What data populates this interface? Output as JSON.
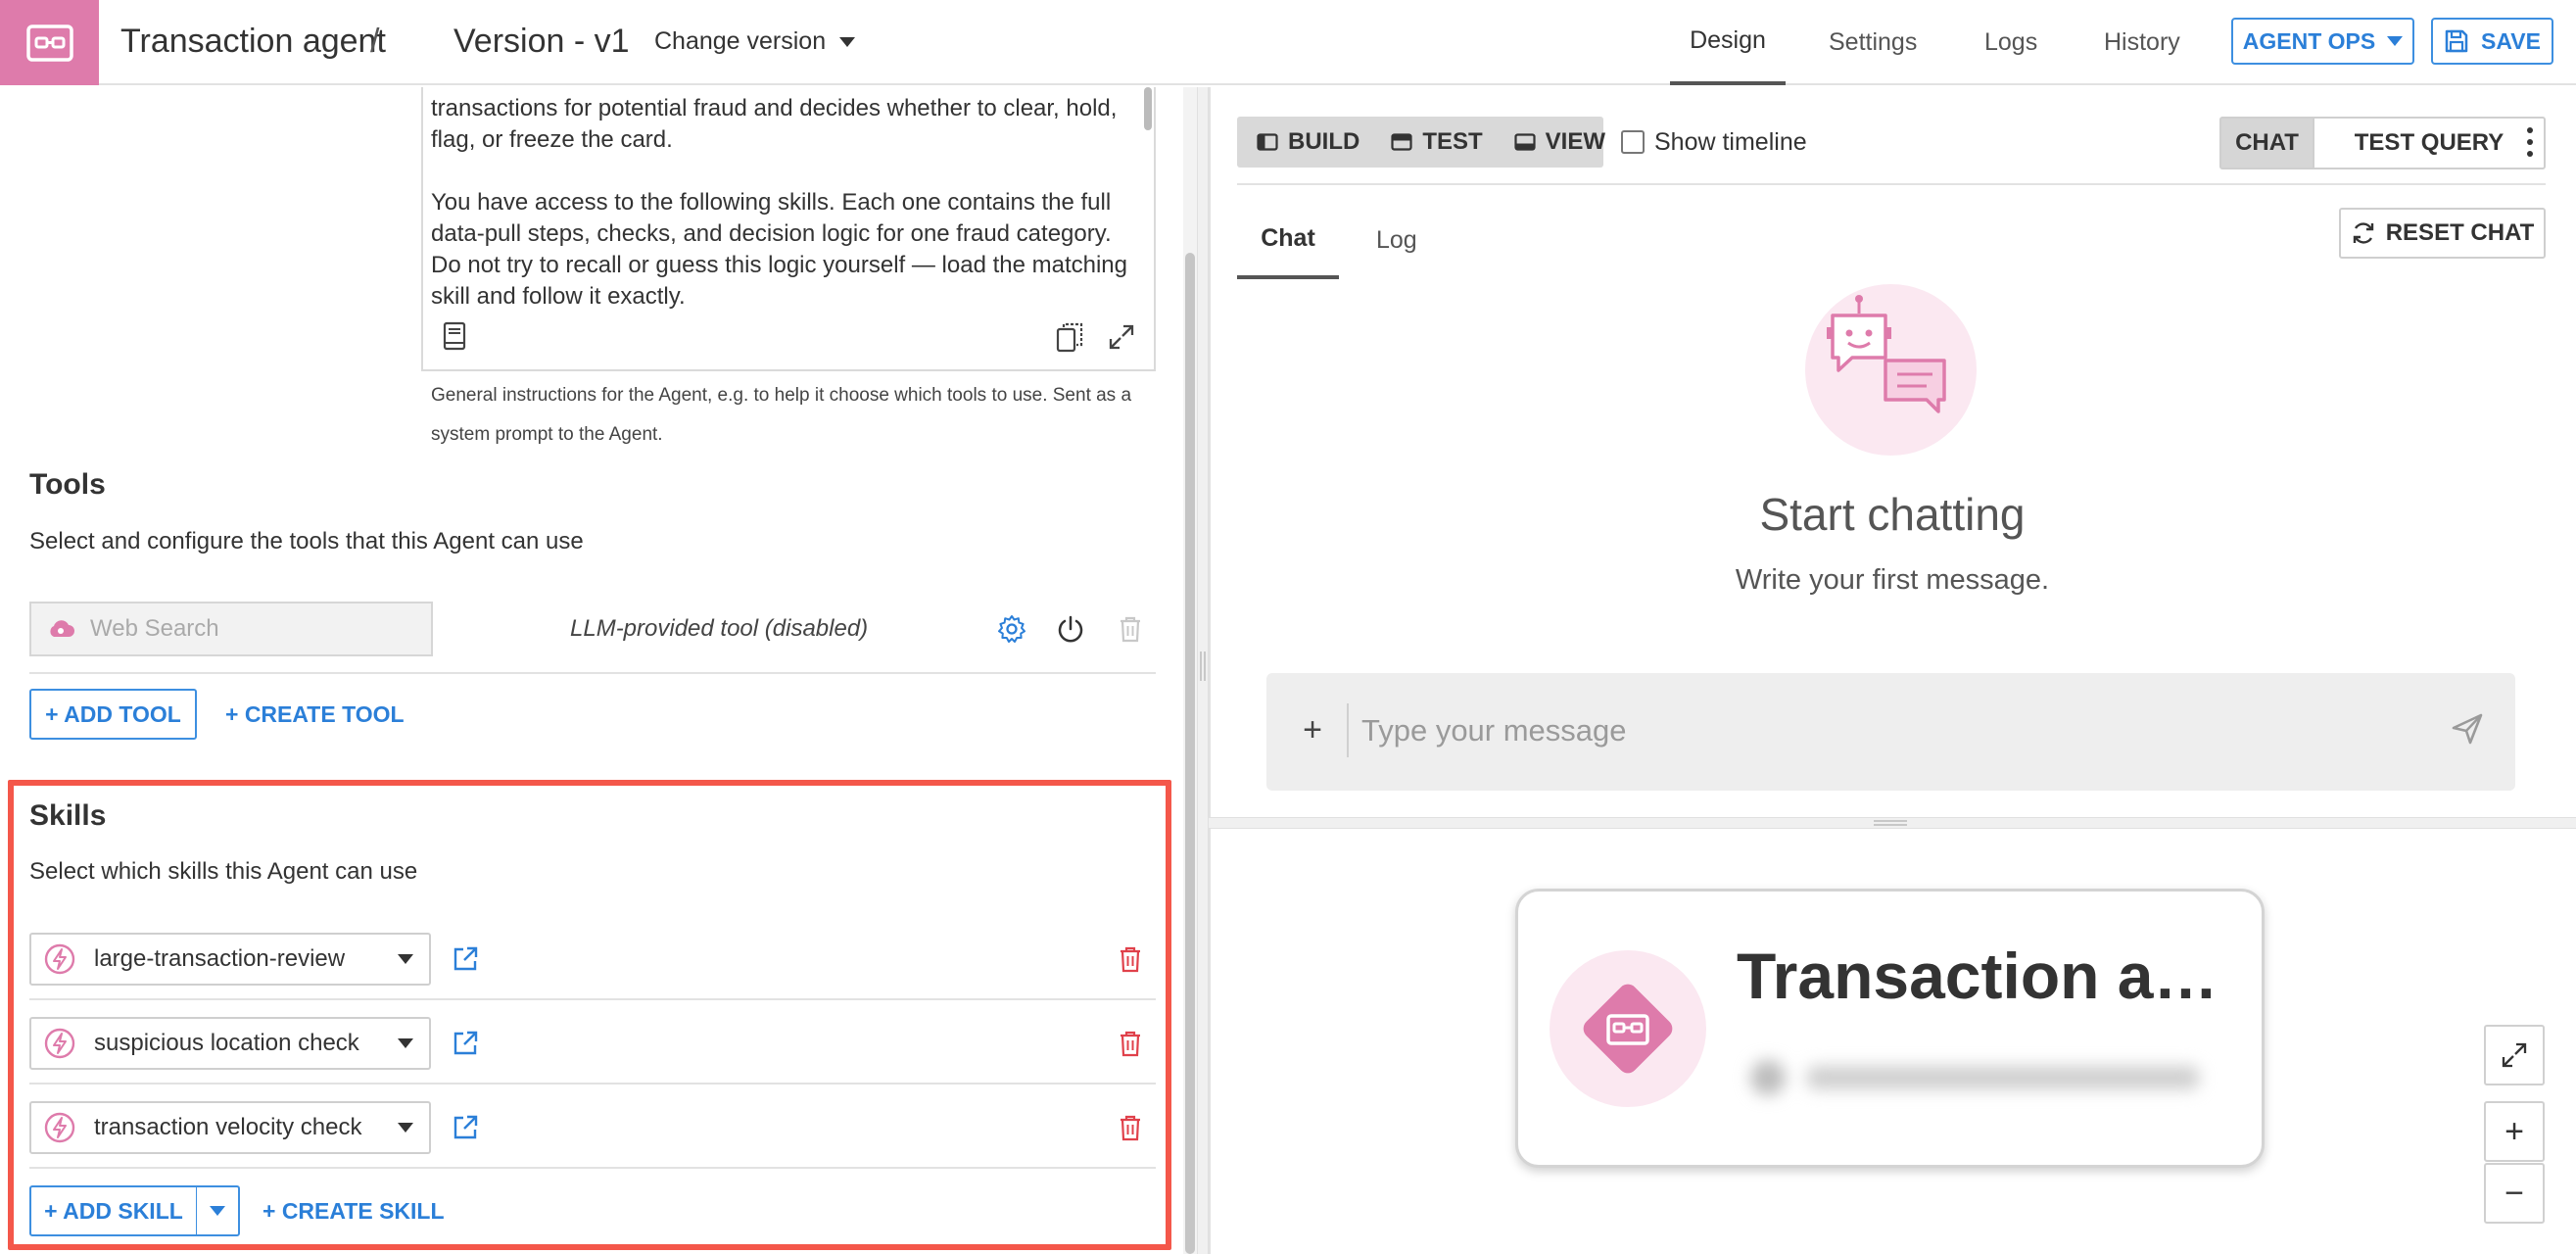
{
  "header": {
    "agent_name": "Transaction agent",
    "separator": "/",
    "version": "Version - v1",
    "change_version": "Change version",
    "tabs": [
      "Design",
      "Settings",
      "Logs",
      "History"
    ],
    "active_tab": "Design",
    "agent_ops_label": "AGENT OPS",
    "save_label": "SAVE"
  },
  "instructions": {
    "text_paragraph_1": "transactions for potential fraud and decides whether to clear, hold, flag, or freeze the card.",
    "text_paragraph_2": "You have access to the following skills. Each one contains the full data-pull steps, checks, and decision logic for one fraud category. Do not try to recall or guess this logic yourself — load the matching skill and follow it exactly.",
    "help": "General instructions for the Agent, e.g. to help it choose which tools to use. Sent as a system prompt to the Agent."
  },
  "tools": {
    "title": "Tools",
    "subtitle": "Select and configure the tools that this Agent can use",
    "items": [
      {
        "name": "Web Search",
        "note": "LLM-provided tool (disabled)"
      }
    ],
    "add_label": "+ ADD TOOL",
    "create_label": "+ CREATE TOOL"
  },
  "skills": {
    "title": "Skills",
    "subtitle": "Select which skills this Agent can use",
    "items": [
      {
        "name": "large-transaction-review"
      },
      {
        "name": "suspicious location check"
      },
      {
        "name": "transaction velocity check"
      }
    ],
    "add_label": "+ ADD SKILL",
    "create_label": "+ CREATE SKILL"
  },
  "chat_panel": {
    "modes": [
      "BUILD",
      "TEST",
      "VIEW"
    ],
    "show_timeline_label": "Show timeline",
    "show_timeline_checked": false,
    "segments": [
      "CHAT",
      "TEST QUERY"
    ],
    "active_segment": "CHAT",
    "tabs": [
      "Chat",
      "Log"
    ],
    "active_tab": "Chat",
    "reset_label": "RESET CHAT",
    "empty_title": "Start chatting",
    "empty_subtitle": "Write your first message.",
    "input_placeholder": "Type your message"
  },
  "preview": {
    "agent_card_title": "Transaction a…"
  },
  "colors": {
    "brand_pink": "#de7bab",
    "accent_blue": "#2b7fd8",
    "highlight_red": "#f4574a",
    "delete_red": "#e0414b"
  }
}
